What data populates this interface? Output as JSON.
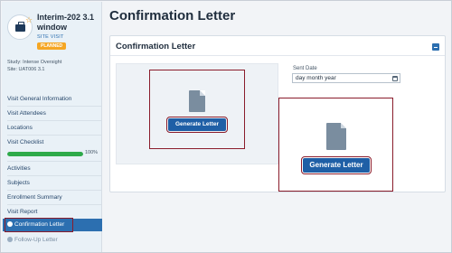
{
  "visit": {
    "title": "Interim-202 3.1 window",
    "type": "SITE VISIT",
    "status": "PLANNED",
    "study": "Study: Intense Oversight",
    "site": "Site: UAT006 3.1",
    "icon": "briefcase-star-icon"
  },
  "sidebar": {
    "items": [
      {
        "label": "Visit General Information"
      },
      {
        "label": "Visit Attendees"
      },
      {
        "label": "Locations"
      },
      {
        "label": "Visit Checklist"
      },
      {
        "label": "Activities"
      },
      {
        "label": "Subjects"
      },
      {
        "label": "Enrollment Summary"
      },
      {
        "label": "Visit Report"
      }
    ],
    "checklist_progress": {
      "label": "100%",
      "fraction": 1.0
    },
    "active_item": "Confirmation Letter",
    "followup_item": "Follow-Up Letter"
  },
  "page": {
    "title": "Confirmation Letter"
  },
  "card": {
    "title": "Confirmation Letter",
    "generate_label": "Generate Letter",
    "sent_date_label": "Sent Date",
    "sent_date_value": "day month year",
    "icons": [
      "document-icon",
      "calendar-icon",
      "collapse-icon"
    ]
  },
  "colors": {
    "accent": "#2c6fb0",
    "button": "#1f5fa6",
    "highlight": "#8a1c2b",
    "progress": "#2eaa4a",
    "status": "#f5a623"
  }
}
